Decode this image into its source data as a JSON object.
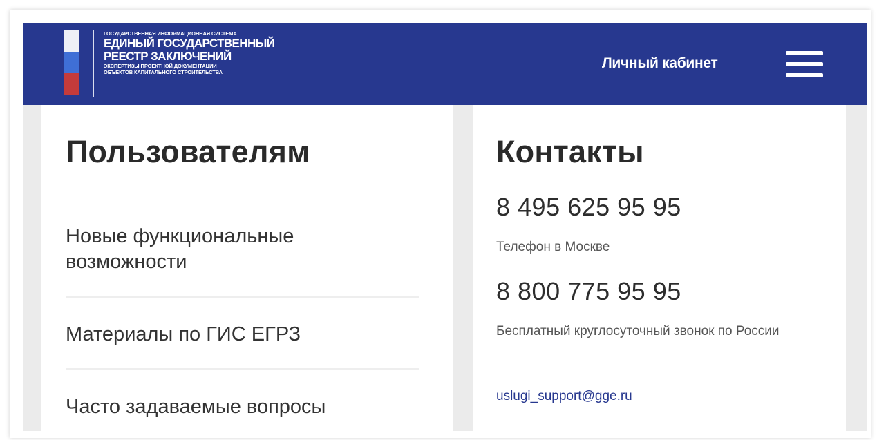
{
  "header": {
    "logo": {
      "line_top": "ГОСУДАРСТВЕННАЯ ИНФОРМАЦИОННАЯ СИСТЕМА",
      "line_1": "ЕДИНЫЙ ГОСУДАРСТВЕННЫЙ",
      "line_2": "РЕЕСТР ЗАКЛЮЧЕНИЙ",
      "line_3": "ЭКСПЕРТИЗЫ ПРОЕКТНОЙ ДОКУМЕНТАЦИИ",
      "line_4": "ОБЪЕКТОВ КАПИТАЛЬНОГО СТРОИТЕЛЬСТВА"
    },
    "cabinet_label": "Личный кабинет",
    "menu_icon": "hamburger-menu-icon",
    "background_color": "#27388f"
  },
  "users_section": {
    "title": "Пользователям",
    "items": [
      "Новые функциональные возможности",
      "Материалы по ГИС ЕГРЗ",
      "Часто задаваемые вопросы"
    ]
  },
  "contacts_section": {
    "title": "Контакты",
    "phone_moscow": "8 495 625 95 95",
    "phone_moscow_caption": "Телефон в Москве",
    "phone_free": "8 800 775 95 95",
    "phone_free_caption": "Бесплатный круглосуточный звонок по России",
    "email": "uslugi_support@gge.ru"
  }
}
